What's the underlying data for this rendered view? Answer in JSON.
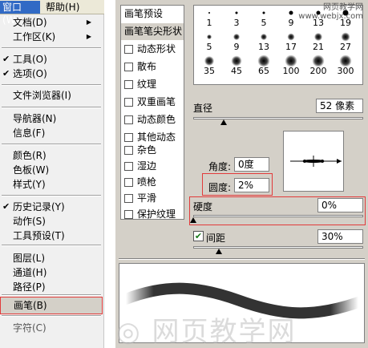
{
  "menubar": {
    "window_label": "窗口(W)",
    "help_label": "帮助(H)"
  },
  "menu": {
    "items": [
      {
        "label": "文档(D)",
        "checked": false,
        "submenu": true
      },
      {
        "label": "工作区(K)",
        "checked": false,
        "submenu": true
      },
      {
        "label": "工具(O)",
        "checked": true,
        "submenu": false
      },
      {
        "label": "选项(O)",
        "checked": true,
        "submenu": false
      },
      {
        "label": "文件浏览器(I)",
        "checked": false,
        "submenu": false
      },
      {
        "label": "导航器(N)",
        "checked": false,
        "submenu": false
      },
      {
        "label": "信息(F)",
        "checked": false,
        "submenu": false
      },
      {
        "label": "颜色(R)",
        "checked": false,
        "submenu": false
      },
      {
        "label": "色板(W)",
        "checked": false,
        "submenu": false
      },
      {
        "label": "样式(Y)",
        "checked": false,
        "submenu": false
      },
      {
        "label": "历史记录(Y)",
        "checked": true,
        "submenu": false
      },
      {
        "label": "动作(S)",
        "checked": false,
        "submenu": false
      },
      {
        "label": "工具预设(T)",
        "checked": false,
        "submenu": false
      },
      {
        "label": "图层(L)",
        "checked": false,
        "submenu": false
      },
      {
        "label": "通道(H)",
        "checked": false,
        "submenu": false
      },
      {
        "label": "路径(P)",
        "checked": false,
        "submenu": false
      },
      {
        "label": "画笔(B)",
        "checked": false,
        "submenu": false
      },
      {
        "label": "字符(C)",
        "checked": false,
        "submenu": false
      }
    ]
  },
  "brush_panel": {
    "options": [
      {
        "label": "画笔预设",
        "has_checkbox": false,
        "selected": false
      },
      {
        "label": "画笔笔尖形状",
        "has_checkbox": false,
        "selected": true
      },
      {
        "label": "动态形状",
        "has_checkbox": true,
        "selected": false
      },
      {
        "label": "散布",
        "has_checkbox": true,
        "selected": false
      },
      {
        "label": "纹理",
        "has_checkbox": true,
        "selected": false
      },
      {
        "label": "双重画笔",
        "has_checkbox": true,
        "selected": false
      },
      {
        "label": "动态颜色",
        "has_checkbox": true,
        "selected": false
      },
      {
        "label": "其他动态",
        "has_checkbox": true,
        "selected": false
      },
      {
        "label": "杂色",
        "has_checkbox": true,
        "selected": false
      },
      {
        "label": "湿边",
        "has_checkbox": true,
        "selected": false
      },
      {
        "label": "喷枪",
        "has_checkbox": true,
        "selected": false
      },
      {
        "label": "平滑",
        "has_checkbox": true,
        "selected": false
      },
      {
        "label": "保护纹理",
        "has_checkbox": true,
        "selected": false
      }
    ],
    "tips": [
      {
        "size": "1",
        "soft": false
      },
      {
        "size": "3",
        "soft": false
      },
      {
        "size": "5",
        "soft": false
      },
      {
        "size": "9",
        "soft": false
      },
      {
        "size": "13",
        "soft": false
      },
      {
        "size": "19",
        "soft": false
      },
      {
        "size": "5",
        "soft": true
      },
      {
        "size": "9",
        "soft": true
      },
      {
        "size": "13",
        "soft": true
      },
      {
        "size": "17",
        "soft": true
      },
      {
        "size": "21",
        "soft": true
      },
      {
        "size": "27",
        "soft": true
      },
      {
        "size": "35",
        "soft": true
      },
      {
        "size": "45",
        "soft": true
      },
      {
        "size": "65",
        "soft": true
      },
      {
        "size": "100",
        "soft": true
      },
      {
        "size": "200",
        "soft": true
      },
      {
        "size": "300",
        "soft": true
      }
    ],
    "diameter_label": "直径",
    "diameter_value": "52 像素",
    "diameter_fraction": 0.18,
    "angle_label": "角度:",
    "angle_value": "0度",
    "roundness_label": "圆度:",
    "roundness_value": "2%",
    "hardness_label": "硬度",
    "hardness_value": "0%",
    "hardness_fraction": 0.0,
    "spacing_label": "间距",
    "spacing_value": "30%",
    "spacing_fraction": 0.15,
    "spacing_checked": true
  },
  "watermark": {
    "line1": "网页教学网",
    "line2": "www.webjx.com"
  },
  "colors": {
    "highlight": "#316ac5",
    "annotation": "#e23b3b",
    "panel": "#d4d0c8"
  }
}
